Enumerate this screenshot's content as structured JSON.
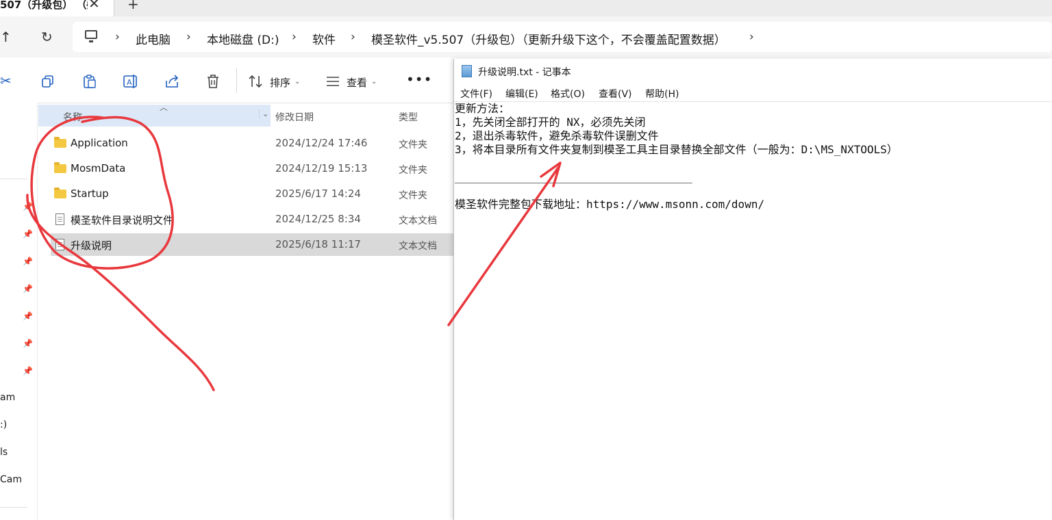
{
  "tab": {
    "title": "507（升级包） （§",
    "close": "✕",
    "new": "+"
  },
  "nav_buttons": {
    "up": "↑",
    "refresh": "↻"
  },
  "breadcrumb": [
    "此电脑",
    "本地磁盘 (D:)",
    "软件",
    "模圣软件_v5.507（升级包）（更新升级下这个，不会覆盖配置数据）"
  ],
  "breadcrumb_sep": "›",
  "toolbar": {
    "sort_label": "排序",
    "view_label": "查看",
    "more": "•••",
    "caret": "⌄"
  },
  "nav_pane": {
    "labels": [
      "am",
      ":)",
      "ls",
      "Cam"
    ]
  },
  "columns": {
    "name": "名称",
    "modified": "修改日期",
    "type": "类型"
  },
  "files": [
    {
      "name": "Application",
      "modified": "2024/12/24 17:46",
      "type": "文件夹",
      "kind": "folder",
      "selected": false
    },
    {
      "name": "MosmData",
      "modified": "2024/12/19 15:13",
      "type": "文件夹",
      "kind": "folder",
      "selected": false
    },
    {
      "name": "Startup",
      "modified": "2025/6/17 14:24",
      "type": "文件夹",
      "kind": "folder",
      "selected": false
    },
    {
      "name": "模圣软件目录说明文件",
      "modified": "2024/12/25 8:34",
      "type": "文本文档",
      "kind": "text",
      "selected": false
    },
    {
      "name": "升级说明",
      "modified": "2025/6/18 11:17",
      "type": "文本文档",
      "kind": "text",
      "selected": true
    }
  ],
  "notepad": {
    "title": "升级说明.txt - 记事本",
    "menu": [
      "文件(F)",
      "编辑(E)",
      "格式(O)",
      "查看(V)",
      "帮助(H)"
    ],
    "content": "更新方法：\n1，先关闭全部打开的 NX，必须先关闭\n2，退出杀毒软件，避免杀毒软件误删文件\n3，将本目录所有文件夹复制到模圣工具主目录替换全部文件（一般为：D:\\MS_NXTOOLS）\n\n____________________________________\n\n模圣软件完整包下载地址：https://www.msonn.com/down/"
  },
  "colors": {
    "annotation": "#e8383d",
    "selection": "#d9d9d9",
    "header_selected": "#dce8f7",
    "folder": "#f5c842"
  }
}
